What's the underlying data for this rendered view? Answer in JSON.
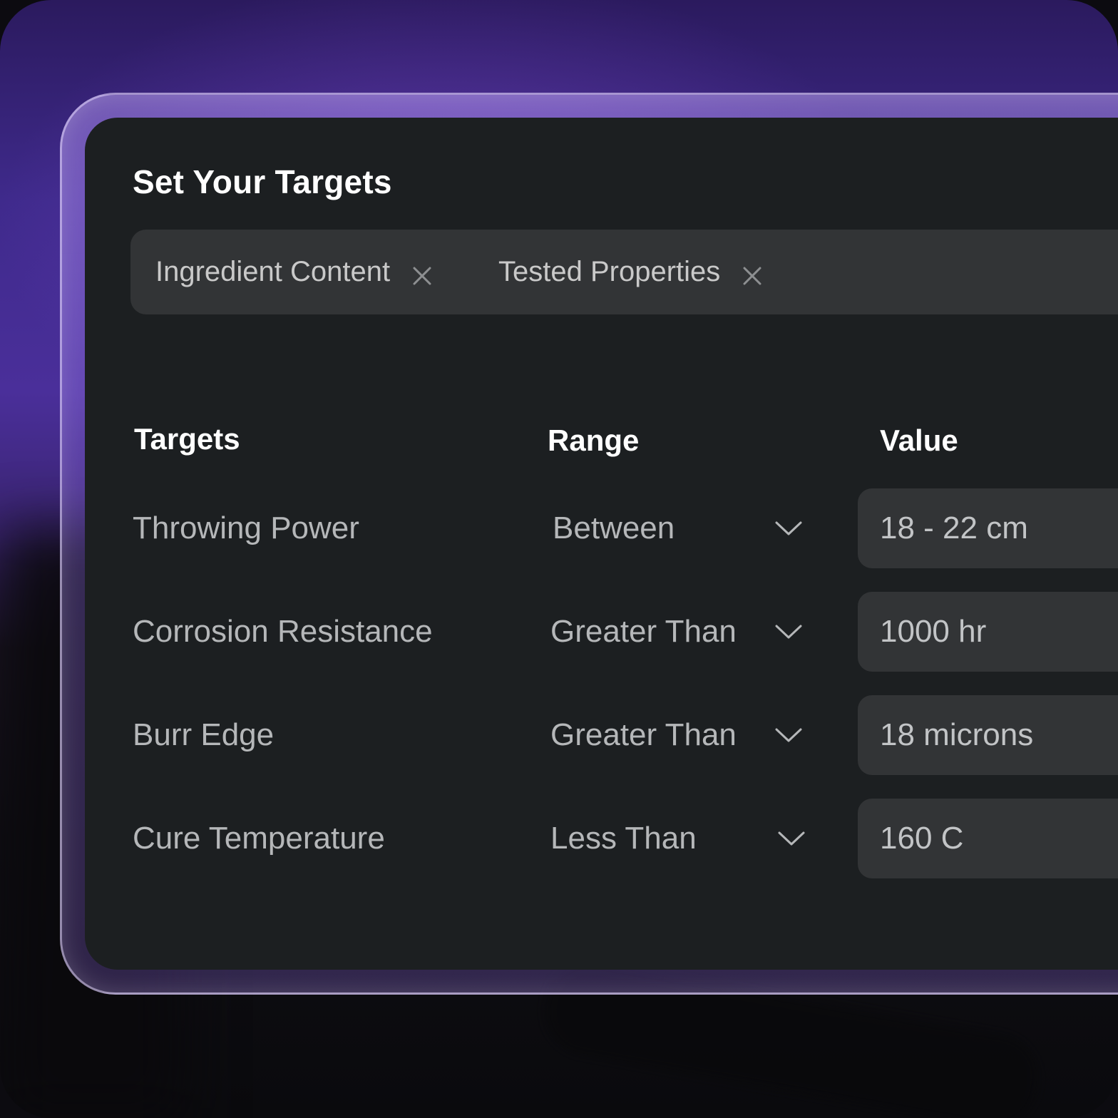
{
  "header": {
    "title": "Set Your Targets"
  },
  "filters": [
    {
      "label": "Ingredient Content",
      "remove_icon": "close-icon"
    },
    {
      "label": "Tested Properties",
      "remove_icon": "close-icon"
    }
  ],
  "table": {
    "columns": {
      "targets": "Targets",
      "range": "Range",
      "value": "Value"
    },
    "rows": [
      {
        "target": "Throwing Power",
        "range": "Between",
        "value": "18 - 22 cm"
      },
      {
        "target": "Corrosion Resistance",
        "range": "Greater Than",
        "value": "1000 hr"
      },
      {
        "target": "Burr Edge",
        "range": "Greater Than",
        "value": "18 microns"
      },
      {
        "target": "Cure Temperature",
        "range": "Less Than",
        "value": "160 C"
      }
    ]
  },
  "colors": {
    "panel": "#1c1f21",
    "field": "#323436",
    "accent_purple": "#4a2f9a",
    "text_primary": "#ffffff",
    "text_secondary": "#b5b7b9"
  },
  "icons": {
    "chip_remove": "close-icon",
    "range_dropdown": "chevron-down-icon"
  }
}
